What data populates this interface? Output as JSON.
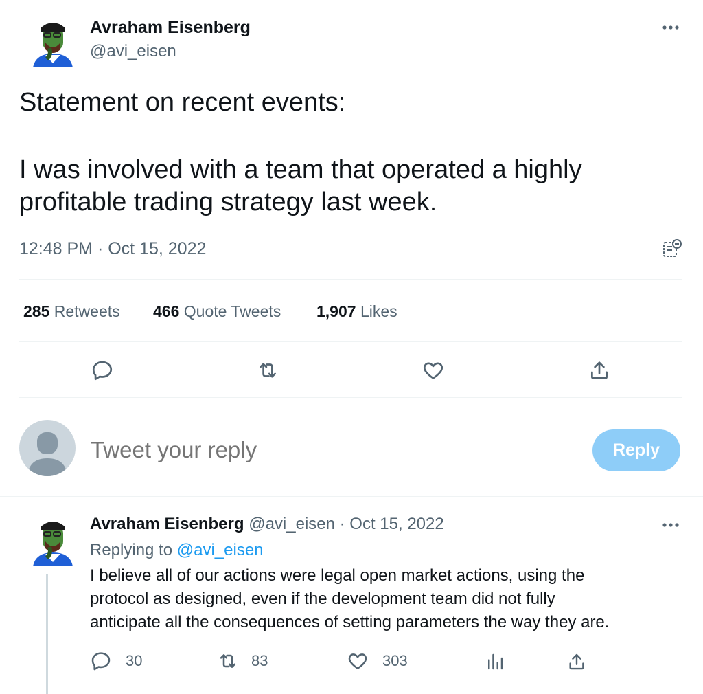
{
  "tweet": {
    "author_name": "Avraham Eisenberg",
    "author_handle": "@avi_eisen",
    "text_line1": "Statement on recent events:",
    "text_line2": "I was involved with a team that operated a highly",
    "text_line3": "profitable trading strategy last week.",
    "timestamp": "12:48 PM · Oct 15, 2022",
    "stats": {
      "retweets_count": "285",
      "retweets_label": "Retweets",
      "quotes_count": "466",
      "quotes_label": "Quote Tweets",
      "likes_count": "1,907",
      "likes_label": "Likes"
    }
  },
  "reply_box": {
    "placeholder": "Tweet your reply",
    "button_label": "Reply"
  },
  "reply_tweet": {
    "author_name": "Avraham Eisenberg",
    "author_handle": "@avi_eisen",
    "date": "· Oct 15, 2022",
    "replying_to_label": "Replying to",
    "replying_to_handle": "@avi_eisen",
    "text_line1": "I believe all of our actions were legal open market actions, using the",
    "text_line2": "protocol as designed, even if the development team did not fully",
    "text_line3": "anticipate all the consequences of setting parameters the way they are.",
    "reply_count": "30",
    "retweet_count": "83",
    "like_count": "303"
  },
  "colors": {
    "accent": "#1d9bf0",
    "reply_button_disabled": "#8ecdf8",
    "muted_text": "#536471",
    "divider": "#eff3f4"
  },
  "icons": [
    "more-icon",
    "reply-icon",
    "retweet-icon",
    "like-icon",
    "share-icon",
    "analytics-icon",
    "view-edit-history-icon"
  ]
}
